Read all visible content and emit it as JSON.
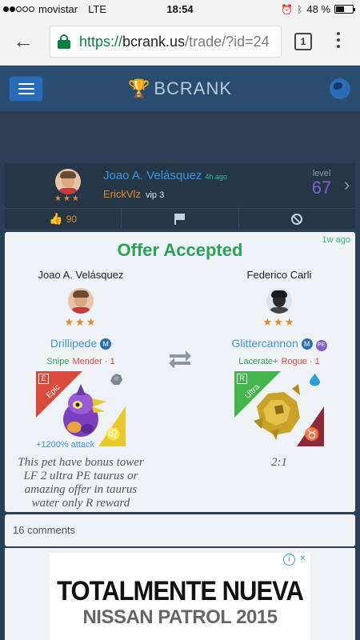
{
  "status_bar": {
    "carrier": "movistar",
    "network": "LTE",
    "time": "18:54",
    "battery": "48 %",
    "battery_level": 0.48,
    "signal_bars": 2,
    "signal_max": 5
  },
  "browser": {
    "url_scheme": "https://",
    "url_host": "bcrank.us",
    "url_path": "/trade/?id=24",
    "tab_count": "1",
    "secure_color": "#0b8043"
  },
  "app": {
    "brand": "BCRANK",
    "trophy_icon": "trophy-icon",
    "menu_icon": "hamburger-icon",
    "globe_icon": "globe-icon"
  },
  "user_card": {
    "name": "Joao A. Velásquez",
    "posted_ago": "4h ago",
    "handle": "ErickVlz",
    "vip": "vip 3",
    "stars": "★★★",
    "level_label": "level",
    "level": "67",
    "likes": "90",
    "level_color": "#7e62c9",
    "accent_color": "#e0892a"
  },
  "offer": {
    "status": "Offer Accepted",
    "time_ago": "1w ago",
    "status_color": "#2aa35a",
    "left": {
      "player": "Joao A. Velásquez",
      "stars": "★★★",
      "pet": "Drillipede",
      "badges": [
        "M"
      ],
      "skill_primary": "Snipe",
      "skill_secondary": "Mender · 1",
      "rarity_letter": "E",
      "rarity": "Epic",
      "rarity_color": "#d84b3a",
      "element_icon": "stone-icon",
      "zodiac_icon": "leo-icon",
      "zodiac_glyph": "♌",
      "bonus": "+1200% attack",
      "note": "This pet have bonus tower LF 2 ultra PE taurus or amazing offer in taurus water only R reward"
    },
    "right": {
      "player": "Federico Carli",
      "stars": "★★★",
      "pet": "Glittercannon",
      "badges": [
        "M",
        "PE"
      ],
      "skill_primary": "Lacerate+",
      "skill_secondary": "Rogue · 1",
      "rarity_letter": "R",
      "rarity": "Ultra",
      "rarity_color": "#43b54a",
      "element_icon": "water-drop-icon",
      "zodiac_icon": "taurus-icon",
      "zodiac_glyph": "♉",
      "note": "2:1"
    },
    "swap_icon": "swap-arrows-icon"
  },
  "comments": {
    "label": "16 comments"
  },
  "ad": {
    "line1": "TOTALMENTE NUEVA",
    "line2": "NISSAN PATROL 2015",
    "info_icon": "ad-info-icon",
    "close_icon": "ad-close-icon"
  }
}
